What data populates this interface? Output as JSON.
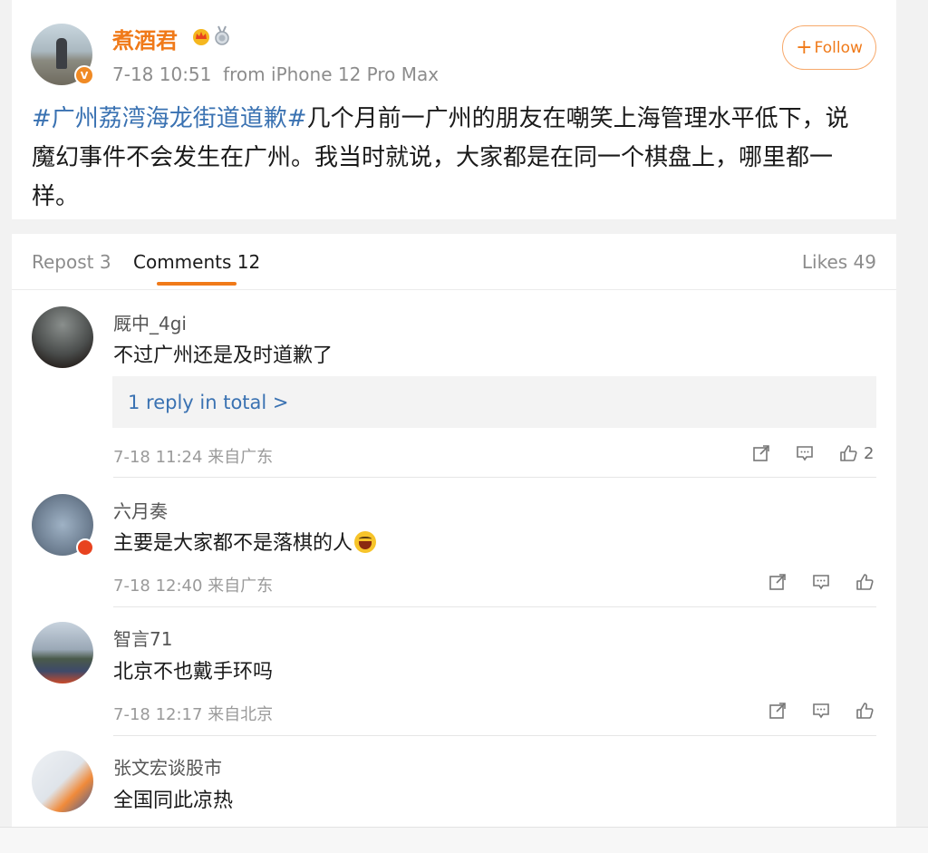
{
  "post": {
    "author": "煮酒君",
    "verified_mark": "V",
    "time": "7-18 10:51",
    "source": "from iPhone 12 Pro Max",
    "follow_label": "Follow",
    "follow_plus": "+",
    "hashtag": "#广州荔湾海龙街道道歉#",
    "text": "几个月前一广州的朋友在嘲笑上海管理水平低下，说魔幻事件不会发生在广州。我当时就说，大家都是在同一个棋盘上，哪里都一样。"
  },
  "tabs": {
    "repost": "Repost 3",
    "comments": "Comments 12",
    "likes": "Likes 49"
  },
  "comments": [
    {
      "name": "厩中_4gi",
      "text": "不过广州还是及时道歉了",
      "reply": "1 reply in total >",
      "time": "7-18 11:24 来自广东",
      "likes": "2"
    },
    {
      "name": "六月奏",
      "text": "主要是大家都不是落棋的人",
      "time": "7-18 12:40 来自广东"
    },
    {
      "name": "智言71",
      "text": "北京不也戴手环吗",
      "time": "7-18 12:17 来自北京"
    },
    {
      "name": "张文宏谈股市",
      "text": "全国同此凉热"
    }
  ],
  "colors": {
    "accent": "#f07a19",
    "link": "#3a72b2",
    "muted": "#8c8c8c"
  },
  "icons": [
    "crown-icon",
    "medal-icon",
    "share-icon",
    "comment-icon",
    "like-icon",
    "laugh-emoji-icon"
  ]
}
